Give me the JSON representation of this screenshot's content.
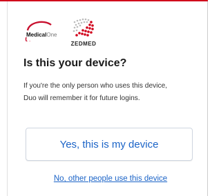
{
  "logos": {
    "medicalone_bold": "Medical",
    "medicalone_light": "One",
    "zedmed": "ZEDMED"
  },
  "prompt": {
    "title": "Is this your device?",
    "description_line1": "If you're the only person who uses this device,",
    "description_line2": "Duo will remember it for future logins."
  },
  "actions": {
    "confirm_label": "Yes, this is my device",
    "decline_label": "No, other people use this device"
  },
  "colors": {
    "accent_red": "#d0021b",
    "link_blue": "#1a63c7"
  }
}
